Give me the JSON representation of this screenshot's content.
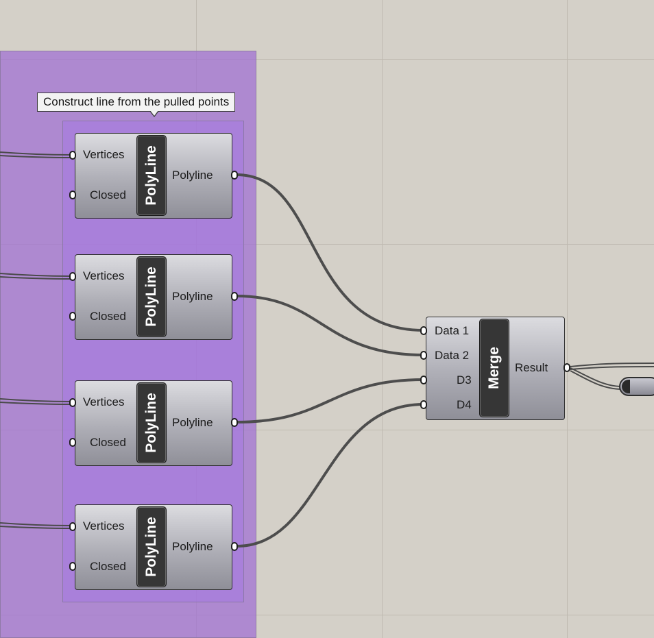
{
  "tooltip": {
    "text": "Construct line from the pulled points"
  },
  "polyline_components": [
    {
      "nickname": "PolyLine",
      "inputs": [
        "Vertices",
        "Closed"
      ],
      "output": "Polyline"
    },
    {
      "nickname": "PolyLine",
      "inputs": [
        "Vertices",
        "Closed"
      ],
      "output": "Polyline"
    },
    {
      "nickname": "PolyLine",
      "inputs": [
        "Vertices",
        "Closed"
      ],
      "output": "Polyline"
    },
    {
      "nickname": "PolyLine",
      "inputs": [
        "Vertices",
        "Closed"
      ],
      "output": "Polyline"
    }
  ],
  "merge_component": {
    "nickname": "Merge",
    "inputs": [
      "Data 1",
      "Data 2",
      "D3",
      "D4"
    ],
    "output": "Result"
  },
  "colors": {
    "canvas": "#d4d0c8",
    "group_fill": "#a06ed2",
    "wire": "#4a4a4a",
    "component_core": "#363636"
  }
}
